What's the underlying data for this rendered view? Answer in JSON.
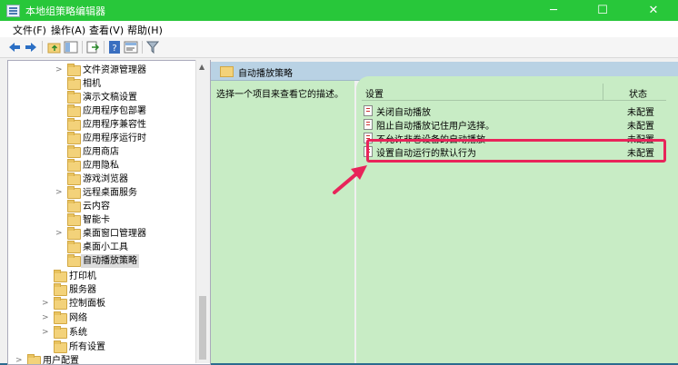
{
  "window": {
    "title": "本地组策略编辑器",
    "minimize": "─",
    "maximize": "☐",
    "close": "✕"
  },
  "menu": [
    "文件(F)",
    "操作(A)",
    "查看(V)",
    "帮助(H)"
  ],
  "tree": {
    "items": [
      {
        "label": "文件资源管理器",
        "expandable": true
      },
      {
        "label": "相机",
        "expandable": false
      },
      {
        "label": "演示文稿设置",
        "expandable": false
      },
      {
        "label": "应用程序包部署",
        "expandable": false
      },
      {
        "label": "应用程序兼容性",
        "expandable": false
      },
      {
        "label": "应用程序运行时",
        "expandable": false
      },
      {
        "label": "应用商店",
        "expandable": false
      },
      {
        "label": "应用隐私",
        "expandable": false
      },
      {
        "label": "游戏浏览器",
        "expandable": false
      },
      {
        "label": "远程桌面服务",
        "expandable": true
      },
      {
        "label": "云内容",
        "expandable": false
      },
      {
        "label": "智能卡",
        "expandable": false
      },
      {
        "label": "桌面窗口管理器",
        "expandable": true
      },
      {
        "label": "桌面小工具",
        "expandable": false
      },
      {
        "label": "自动播放策略",
        "expandable": false,
        "selected": true
      },
      {
        "label": "打印机",
        "expandable": false
      },
      {
        "label": "服务器",
        "expandable": false
      },
      {
        "label": "控制面板",
        "expandable": true
      },
      {
        "label": "网络",
        "expandable": true
      },
      {
        "label": "系统",
        "expandable": true
      },
      {
        "label": "所有设置",
        "expandable": false
      },
      {
        "label": "用户配置",
        "expandable": true
      }
    ]
  },
  "right": {
    "header": "自动播放策略",
    "description": "选择一个项目来查看它的描述。",
    "columns": {
      "setting": "设置",
      "state": "状态"
    },
    "rows": [
      {
        "name": "关闭自动播放",
        "state": "未配置"
      },
      {
        "name": "阻止自动播放记住用户选择。",
        "state": "未配置"
      },
      {
        "name": "不允许非卷设备的自动播放",
        "state": "未配置"
      },
      {
        "name": "设置自动运行的默认行为",
        "state": "未配置"
      }
    ]
  },
  "colors": {
    "titlebar": "#28c73a",
    "pane": "#c8ecc5",
    "highlight": "#e8245a"
  }
}
